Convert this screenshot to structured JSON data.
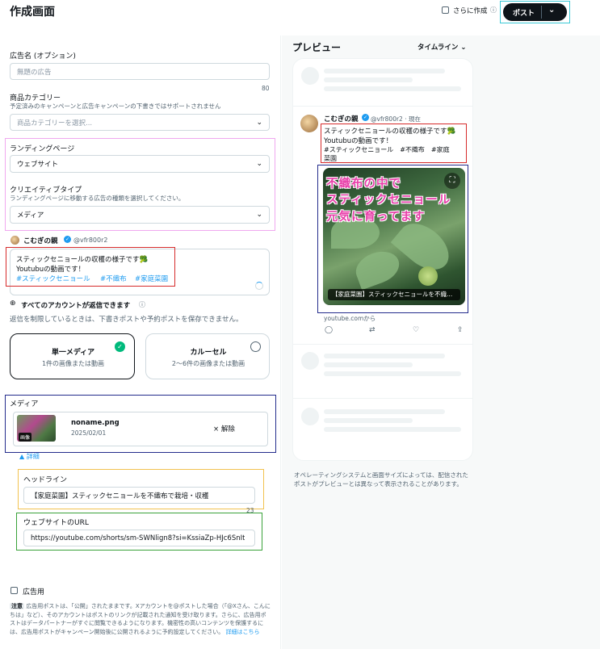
{
  "header": {
    "title": "作成画面",
    "create_more_label": "さらに作成",
    "post_button": "ポスト"
  },
  "form": {
    "ad_name": {
      "label": "広告名 (オプション)",
      "placeholder": "無題の広告",
      "counter": "80"
    },
    "product_category": {
      "label": "商品カテゴリー",
      "note": "予定済みのキャンペーンと広告キャンペーンの下書きではサポートされません",
      "placeholder": "商品カテゴリーを選択..."
    },
    "landing_page": {
      "label": "ランディングページ",
      "value": "ウェブサイト"
    },
    "creative_type": {
      "label": "クリエイティブタイプ",
      "note": "ランディングページに移動する広告の種類を選択してください。",
      "value": "メディア"
    },
    "account": {
      "name": "こむぎの親",
      "handle": "@vfr800r2"
    },
    "tweet": {
      "line1": "スティックセニョールの収穫の様子です🥦",
      "line2": "Youtubuの動画です！",
      "hashtags": [
        "#スティックセニョール",
        "#不織布",
        "#家庭菜園"
      ]
    },
    "reply": {
      "title": "すべてのアカウントが返信できます",
      "note": "返信を制限しているときは、下書きポストや予約ポストを保存できません。"
    },
    "format": {
      "single": {
        "title": "単一メディア",
        "desc": "1件の画像または動画"
      },
      "carousel": {
        "title": "カルーセル",
        "desc": "2〜6件の画像または動画"
      }
    },
    "media": {
      "label": "メディア",
      "badge": "画像",
      "file_name": "noname.png",
      "file_date": "2025/02/01",
      "remove": "× 解除",
      "details": "▲ 詳細"
    },
    "headline": {
      "label": "ヘッドライン",
      "value": "【家庭菜園】スティックセニョールを不織布で栽培・収穫",
      "counter": "23"
    },
    "url": {
      "label": "ウェブサイトのURL",
      "value": "https://youtube.com/shorts/sm-SWNlign8?si=KssiaZp-HJc6SnIt"
    },
    "ad_use": {
      "label": "広告用"
    },
    "notice": {
      "tag": "注意",
      "text": "広告用ポストは、「公開」されたままです。Xアカウントを@ポストした場合（「@Xさん、こんにちは」など）、そのアカウントはポストのリンクが記載された通知を受け取ります。さらに、広告用ポストはデータパートナーがすぐに閲覧できるようになります。機密性の高いコンテンツを保護するには、広告用ポストがキャンペーン開始後に公開されるように予約設定してください。",
      "link": "詳細はこちら"
    }
  },
  "preview": {
    "title": "プレビュー",
    "view_mode": "タイムライン",
    "account_name": "こむぎの親",
    "handle_time": "@vfr800r2 · 現在",
    "tweet_line1": "スティックセニョールの収穫の様子です🥦",
    "tweet_line2": "Youtubuの動画です！",
    "hashtags_line": "#スティックセニョール　#不織布　#家庭",
    "hashtags_line2": "菜園",
    "media_overlay": [
      "不織布の中で",
      "スティックセニョール",
      "元気に育ってます"
    ],
    "media_caption": "【家庭菜園】スティックセニョールを不織...",
    "source": "youtube.comから",
    "disclaimer": "オペレーティングシステムと画面サイズによっては、配信されたポストがプレビューとは異なって表示されることがあります。"
  },
  "colors": {
    "pink_frame": "#f0a8ef",
    "red_frame": "#d62b2b",
    "navy_frame": "#232c8c",
    "yellow_frame": "#f2c24f",
    "green_frame": "#3aa23a",
    "cyan_frame": "#3cc9d6",
    "accent": "#1d9bf0"
  }
}
